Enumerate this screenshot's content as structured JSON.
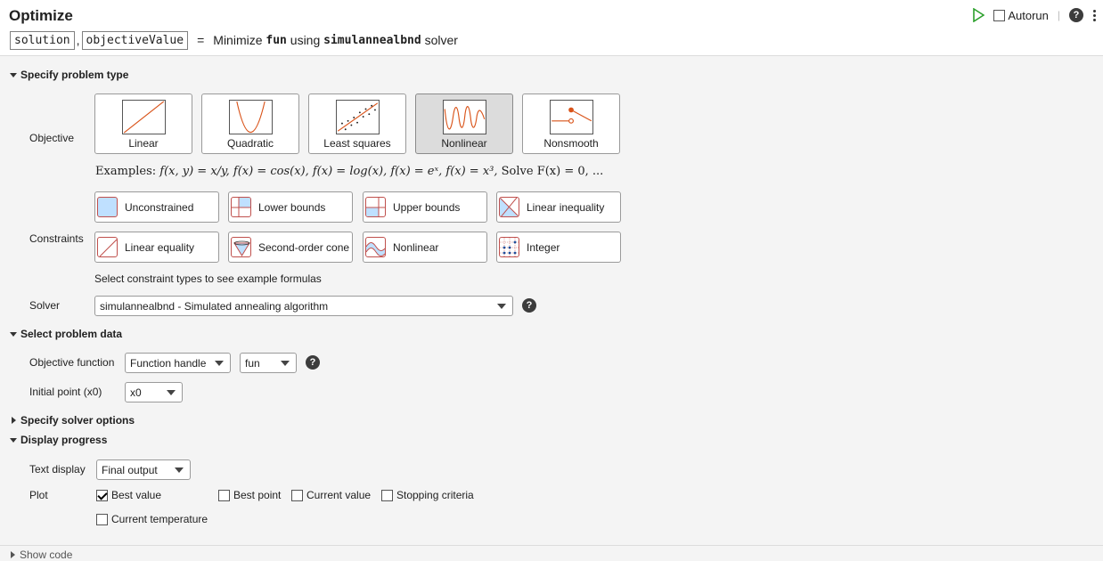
{
  "header": {
    "title": "Optimize",
    "outputs": [
      "solution",
      "objectiveValue"
    ],
    "equals": "=",
    "phrase_minimize": "Minimize",
    "function_name": "fun",
    "phrase_using": "using",
    "solver_name": "simulannealbnd",
    "phrase_solver": "solver",
    "autorun_label": "Autorun",
    "autorun_checked": false,
    "help_glyph": "?",
    "icons": [
      "run-icon",
      "help-icon",
      "more-options-icon"
    ]
  },
  "problem_type": {
    "section_title": "Specify problem type",
    "objective_label": "Objective",
    "objectives": [
      {
        "label": "Linear",
        "selected": false
      },
      {
        "label": "Quadratic",
        "selected": false
      },
      {
        "label": "Least squares",
        "selected": false
      },
      {
        "label": "Nonlinear",
        "selected": true
      },
      {
        "label": "Nonsmooth",
        "selected": false
      }
    ],
    "examples_prefix": "Examples:",
    "examples_text": "f(x, y) = x/y,  f(x) = cos(x),  f(x) = log(x),  f(x) = eˣ,  f(x) = x³,",
    "examples_suffix": "Solve F(x) = 0, ...",
    "constraints_label": "Constraints",
    "constraints": [
      {
        "label": "Unconstrained",
        "icon": "unconstrained-icon"
      },
      {
        "label": "Lower bounds",
        "icon": "lower-bounds-icon"
      },
      {
        "label": "Upper bounds",
        "icon": "upper-bounds-icon"
      },
      {
        "label": "Linear inequality",
        "icon": "linear-inequality-icon"
      },
      {
        "label": "Linear equality",
        "icon": "linear-equality-icon"
      },
      {
        "label": "Second-order cone",
        "icon": "second-order-cone-icon"
      },
      {
        "label": "Nonlinear",
        "icon": "nonlinear-constraint-icon"
      },
      {
        "label": "Integer",
        "icon": "integer-icon"
      }
    ],
    "constraints_hint": "Select constraint types to see example formulas",
    "solver_label": "Solver",
    "solver_value": "simulannealbnd - Simulated annealing algorithm"
  },
  "problem_data": {
    "section_title": "Select problem data",
    "objective_function_label": "Objective function",
    "objective_function_type": "Function handle",
    "objective_function_value": "fun",
    "initial_point_label": "Initial point (x0)",
    "initial_point_value": "x0"
  },
  "solver_options": {
    "section_title": "Specify solver options"
  },
  "display_progress": {
    "section_title": "Display progress",
    "text_display_label": "Text display",
    "text_display_value": "Final output",
    "plot_label": "Plot",
    "plot_options": [
      {
        "label": "Best value",
        "checked": true
      },
      {
        "label": "Best point",
        "checked": false
      },
      {
        "label": "Current value",
        "checked": false
      },
      {
        "label": "Stopping criteria",
        "checked": false
      },
      {
        "label": "Current temperature",
        "checked": false
      }
    ]
  },
  "footer": {
    "show_code_label": "Show code"
  },
  "colors": {
    "accent_plot": "#d95319",
    "run_green": "#2ca02c",
    "constraint_border": "#c0504d",
    "constraint_fill": "#bfe0ff"
  }
}
